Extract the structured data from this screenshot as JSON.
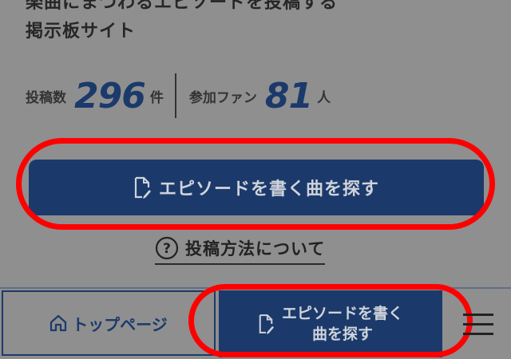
{
  "intro": {
    "line1": "楽曲にまつわるエピソードを投稿する",
    "line2": "掲示板サイト"
  },
  "stats": {
    "posts_label": "投稿数",
    "posts_value": "296",
    "posts_unit": "件",
    "fans_label": "参加ファン",
    "fans_value": "81",
    "fans_unit": "人"
  },
  "cta": {
    "label": "エピソードを書く曲を探す",
    "icon": "document-edit-icon"
  },
  "howto": {
    "label": "投稿方法について",
    "icon": "question-circle-icon"
  },
  "bottom_nav": {
    "home_label": "トップページ",
    "home_icon": "home-icon",
    "episode_line1": "エピソードを書く",
    "episode_line2": "曲を探す",
    "episode_icon": "document-edit-icon",
    "menu_icon": "hamburger-menu-icon"
  },
  "colors": {
    "primary": "#1b3a6b",
    "highlight": "#ff0000",
    "overlay_bg": "#8f8f8f"
  }
}
